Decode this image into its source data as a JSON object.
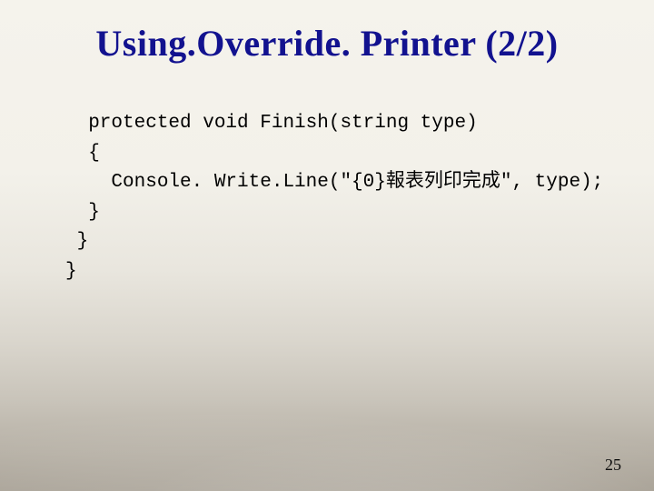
{
  "title": "Using.Override. Printer (2/2)",
  "code": {
    "l1": "  protected void Finish(string type)",
    "l2": "  {",
    "l3": "    Console. Write.Line(\"{0}報表列印完成\", type);",
    "l4": "  }",
    "l5": " }",
    "l6": "}"
  },
  "page_number": "25"
}
